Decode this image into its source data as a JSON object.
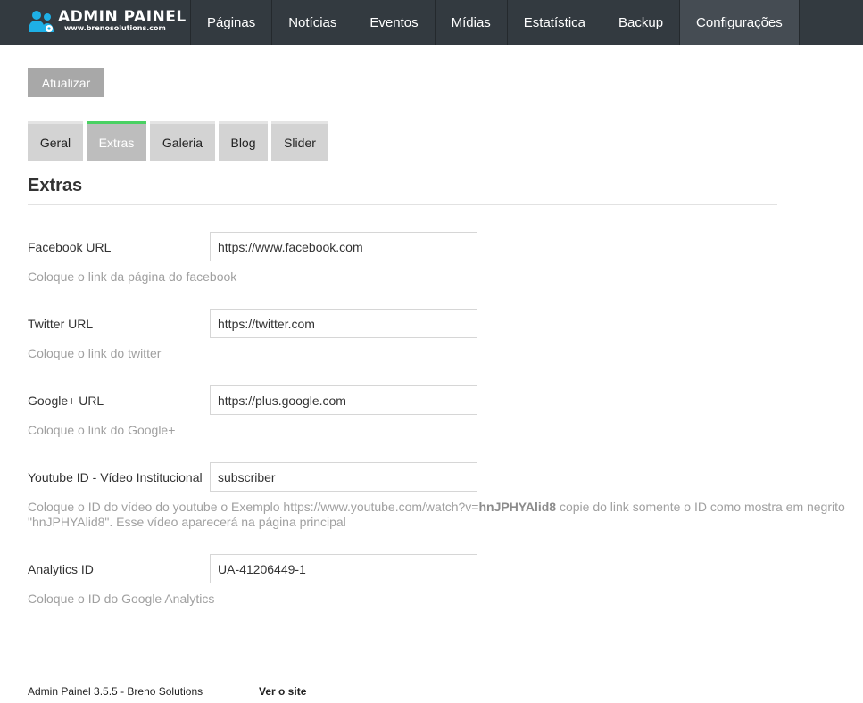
{
  "header": {
    "logo_title": "ADMIN PAINEL",
    "logo_subtitle": "www.brenosolutions.com",
    "logo_icon": "admin-users-icon",
    "nav": [
      {
        "label": "Páginas",
        "active": false
      },
      {
        "label": "Notícias",
        "active": false
      },
      {
        "label": "Eventos",
        "active": false
      },
      {
        "label": "Mídias",
        "active": false
      },
      {
        "label": "Estatística",
        "active": false
      },
      {
        "label": "Backup",
        "active": false
      },
      {
        "label": "Configurações",
        "active": true
      }
    ]
  },
  "toolbar": {
    "update_label": "Atualizar"
  },
  "tabs": [
    {
      "label": "Geral",
      "active": false
    },
    {
      "label": "Extras",
      "active": true
    },
    {
      "label": "Galeria",
      "active": false
    },
    {
      "label": "Blog",
      "active": false
    },
    {
      "label": "Slider",
      "active": false
    }
  ],
  "section": {
    "title": "Extras"
  },
  "fields": {
    "facebook": {
      "label": "Facebook URL",
      "value": "https://www.facebook.com",
      "help": "Coloque o link da página do facebook"
    },
    "twitter": {
      "label": "Twitter URL",
      "value": "https://twitter.com",
      "help": "Coloque o link do twitter"
    },
    "google": {
      "label": "Google+ URL",
      "value": "https://plus.google.com",
      "help": "Coloque o link do Google+"
    },
    "youtube": {
      "label": "Youtube ID - Vídeo Institucional",
      "value": "subscriber",
      "help_before": "Coloque o ID do vídeo do youtube o Exemplo https://www.youtube.com/watch?v=",
      "help_bold": "hnJPHYAlid8",
      "help_after": " copie do link somente o ID como mostra em negrito \"hnJPHYAlid8\". Esse vídeo aparecerá na página principal"
    },
    "analytics": {
      "label": "Analytics ID",
      "value": "UA-41206449-1",
      "help": "Coloque o ID do Google Analytics"
    }
  },
  "footer": {
    "version": "Admin Painel 3.5.5 - Breno Solutions",
    "site_link": "Ver o site"
  },
  "colors": {
    "topbar": "#333a40",
    "nav_active": "#454c53",
    "tab_active_accent": "#49d162",
    "button": "#a8a8a8"
  }
}
